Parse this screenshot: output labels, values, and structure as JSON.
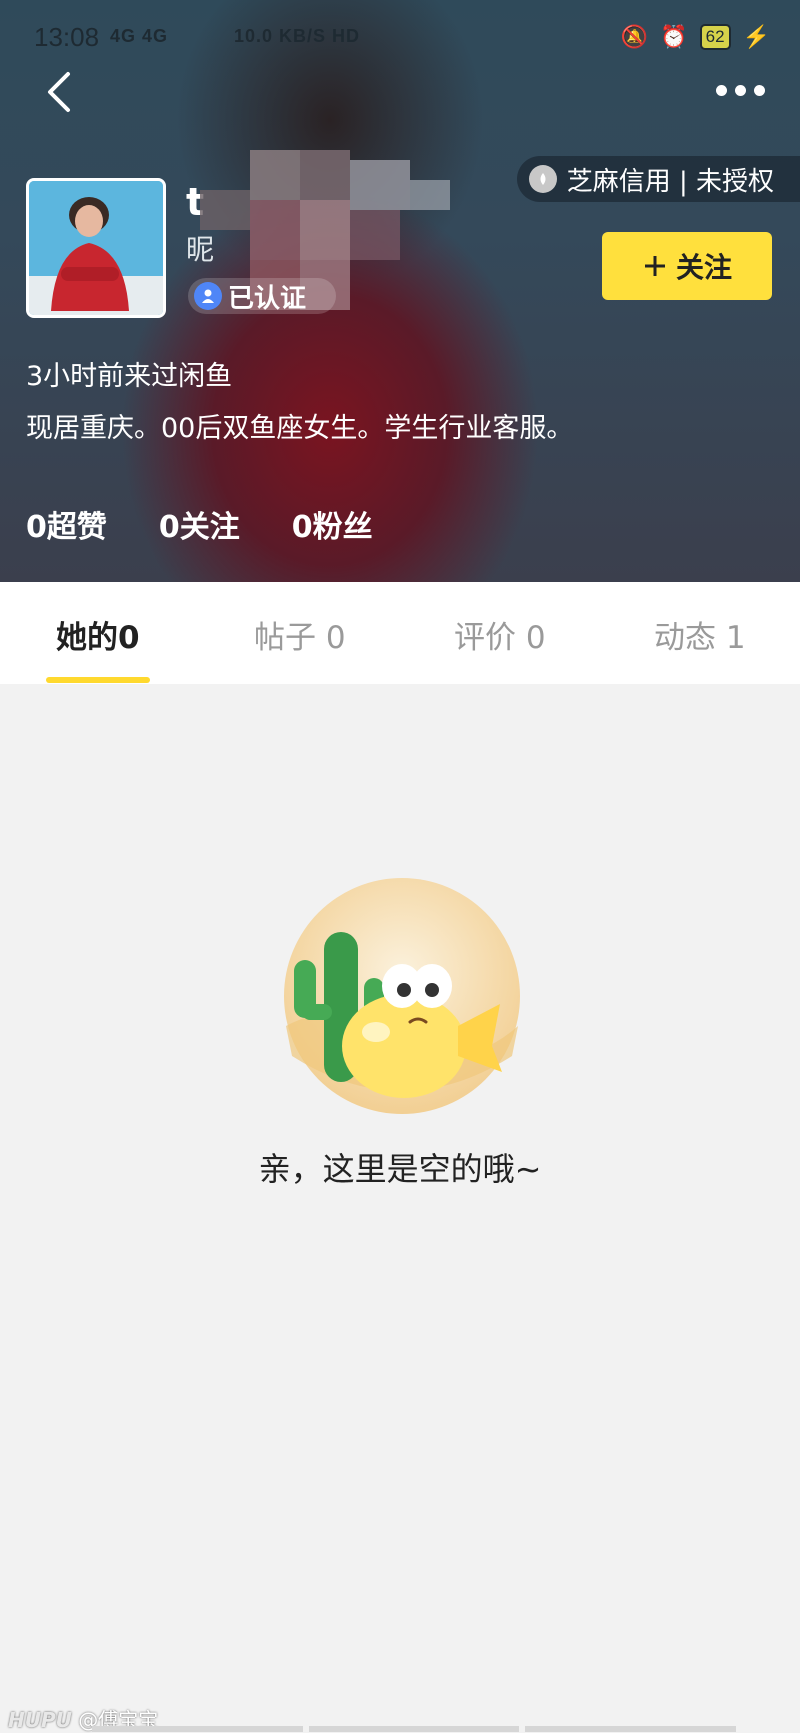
{
  "status_bar": {
    "time": "13:08",
    "network": "4G 4G",
    "speed": "10.0 KB/S HD",
    "battery": "62"
  },
  "profile": {
    "username": "t",
    "nickname_partial": "昵",
    "verified_label": "已认证",
    "credit_label": "芝麻信用 | 未授权",
    "follow_label": "关注",
    "last_seen": "3小时前来过闲鱼",
    "bio": "现居重庆。00后双鱼座女生。学生行业客服。",
    "stats": [
      {
        "label": "0超赞"
      },
      {
        "label": "0关注"
      },
      {
        "label": "0粉丝"
      }
    ]
  },
  "tabs": [
    {
      "label": "她的0",
      "active": true
    },
    {
      "label": "帖子 0",
      "active": false
    },
    {
      "label": "评价 0",
      "active": false
    },
    {
      "label": "动态 1",
      "active": false
    }
  ],
  "empty_state": {
    "message": "亲，这里是空的哦~"
  },
  "watermark": {
    "brand": "HUPU",
    "author": "@傅宝宝"
  },
  "colors": {
    "accent": "#ffe03d",
    "tab_underline": "#ffd92e",
    "header_bg": "#34495a",
    "content_bg": "#f2f2f2"
  }
}
